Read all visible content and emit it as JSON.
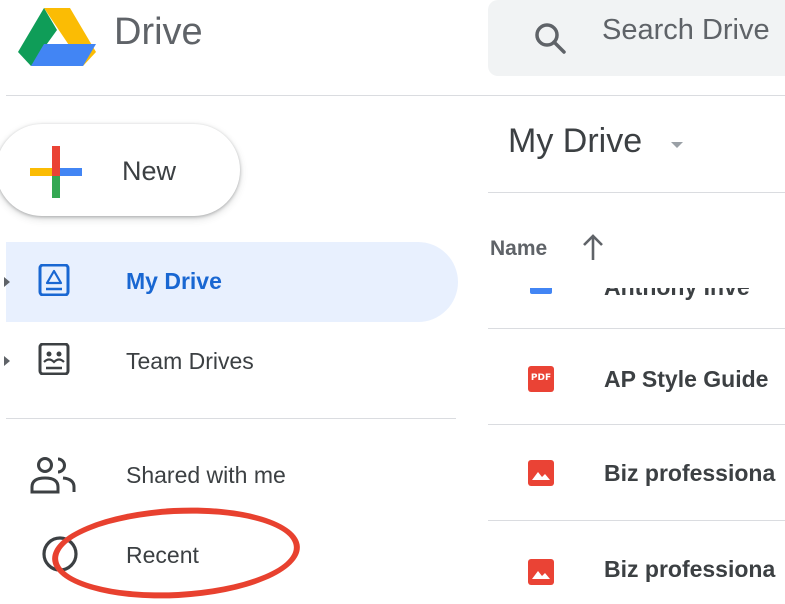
{
  "header": {
    "app_name": "Drive",
    "search_placeholder": "Search Drive"
  },
  "new_button": {
    "label": "New"
  },
  "sidebar": {
    "items": [
      {
        "label": "My Drive",
        "icon": "my-drive-icon",
        "active": true
      },
      {
        "label": "Team Drives",
        "icon": "team-drives-icon",
        "active": false
      },
      {
        "label": "Shared with me",
        "icon": "shared-with-me-icon",
        "active": false
      },
      {
        "label": "Recent",
        "icon": "recent-icon",
        "active": false
      }
    ]
  },
  "main": {
    "title": "My Drive",
    "columns": {
      "name": "Name"
    },
    "files": [
      {
        "name": "Anthony Inve",
        "type": "doc",
        "partial": true
      },
      {
        "name": "AP Style Guide",
        "type": "pdf",
        "badge": "PDF"
      },
      {
        "name": "Biz professiona",
        "type": "image"
      },
      {
        "name": "Biz professiona",
        "type": "image"
      }
    ]
  },
  "colors": {
    "accent_blue": "#1967d2",
    "active_bg": "#e8f0fe",
    "pdf_red": "#ea4335",
    "annotation_red": "#e8412f"
  }
}
